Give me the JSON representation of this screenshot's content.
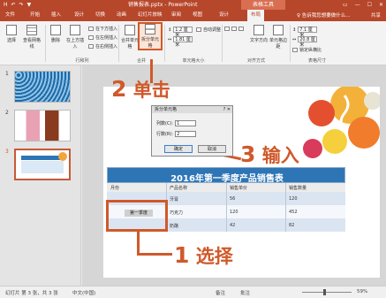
{
  "window": {
    "quick_access": [
      "H",
      "↶",
      "↷",
      "▼"
    ],
    "title": "销售报表.pptx - PowerPoint",
    "contextual_tab": "表格工具",
    "controls": [
      "▭",
      "—",
      "☐",
      "✕"
    ]
  },
  "tabs": [
    "文件",
    "开始",
    "插入",
    "设计",
    "切换",
    "动画",
    "幻灯片放映",
    "审阅",
    "视图",
    "设计",
    "布局"
  ],
  "tell_me": "♀ 告诉我您想要做什么...",
  "user_label": "共享",
  "ribbon": {
    "select_label": "选择",
    "gridlines_label": "查看网格线",
    "delete_label": "删除",
    "insert_above_label": "在上方插入",
    "insert_below_label": "在下方插入",
    "insert_left_label": "在左侧插入",
    "insert_right_label": "在右侧插入",
    "merge_label": "合并单元格",
    "split_label": "拆分单元格",
    "height_value": "1.2 厘米",
    "width_value": "1.81 厘米",
    "autofit_label": "自动调整",
    "align_label": "对齐方式",
    "text_direction_label": "文字方向",
    "cell_margin_label": "单元格边距",
    "table_height_value": "7.1 厘米",
    "table_width_value": "20.8 厘米",
    "lock_ratio_label": "锁定纵横比",
    "groups": [
      "行和列",
      "合并",
      "单元格大小",
      "对齐方式",
      "表格尺寸"
    ]
  },
  "slides": [
    "1",
    "2",
    "3"
  ],
  "dialog": {
    "title": "拆分单元格",
    "close": "?  ✕",
    "columns_label": "列数(C):",
    "columns_value": "1",
    "rows_label": "行数(R):",
    "rows_value": "2",
    "ok": "确定",
    "cancel": "取消"
  },
  "table": {
    "title": "2016年第一季度产品销售表",
    "headers": [
      "月份",
      "产品名称",
      "销售单价",
      "销售数量"
    ],
    "rows": [
      [
        "",
        "牙膏",
        "56",
        "120"
      ],
      [
        "",
        "巧克力",
        "120",
        "452"
      ],
      [
        "",
        "奶酪",
        "42",
        "82"
      ]
    ],
    "selected_cell_text": "第一季度"
  },
  "callouts": {
    "step1_num": "1",
    "step1_text": "选择",
    "step2_num": "2",
    "step2_text": "单击",
    "step3_num": "3",
    "step3_text": "输入"
  },
  "status": {
    "slide_info": "幻灯片 第 3 张，共 3 张",
    "language": "中文(中国)",
    "notes": "备注",
    "comments": "批注",
    "zoom": "59%"
  },
  "colors": {
    "title_bar": "#b7472a",
    "accent": "#d0592a",
    "table_header": "#2e75b6",
    "dialog_bg": "#f0f0f0"
  }
}
